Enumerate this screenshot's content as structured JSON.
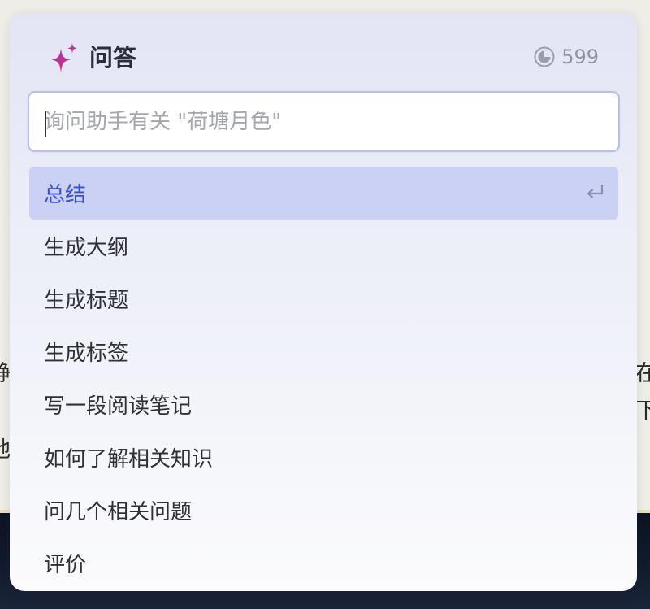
{
  "panel": {
    "title": "问答",
    "credits": {
      "icon": "coin-icon",
      "value": "599"
    },
    "search": {
      "placeholder": "询问助手有关 \"荷塘月色\""
    },
    "items": [
      {
        "label": "总结",
        "selected": true,
        "shortcut_icon": "enter-icon"
      },
      {
        "label": "生成大纲"
      },
      {
        "label": "生成标题"
      },
      {
        "label": "生成标签"
      },
      {
        "label": "写一段阅读笔记"
      },
      {
        "label": "如何了解相关知识"
      },
      {
        "label": "问几个相关问题"
      },
      {
        "label": "评价"
      }
    ]
  },
  "background_fragments": [
    "静",
    "地",
    "在",
    "下"
  ],
  "colors": {
    "accent": "#3a4fd1",
    "selected_bg": "#cbd1f5",
    "sparkle_gradient": [
      "#8e44ad",
      "#e0287a"
    ]
  }
}
